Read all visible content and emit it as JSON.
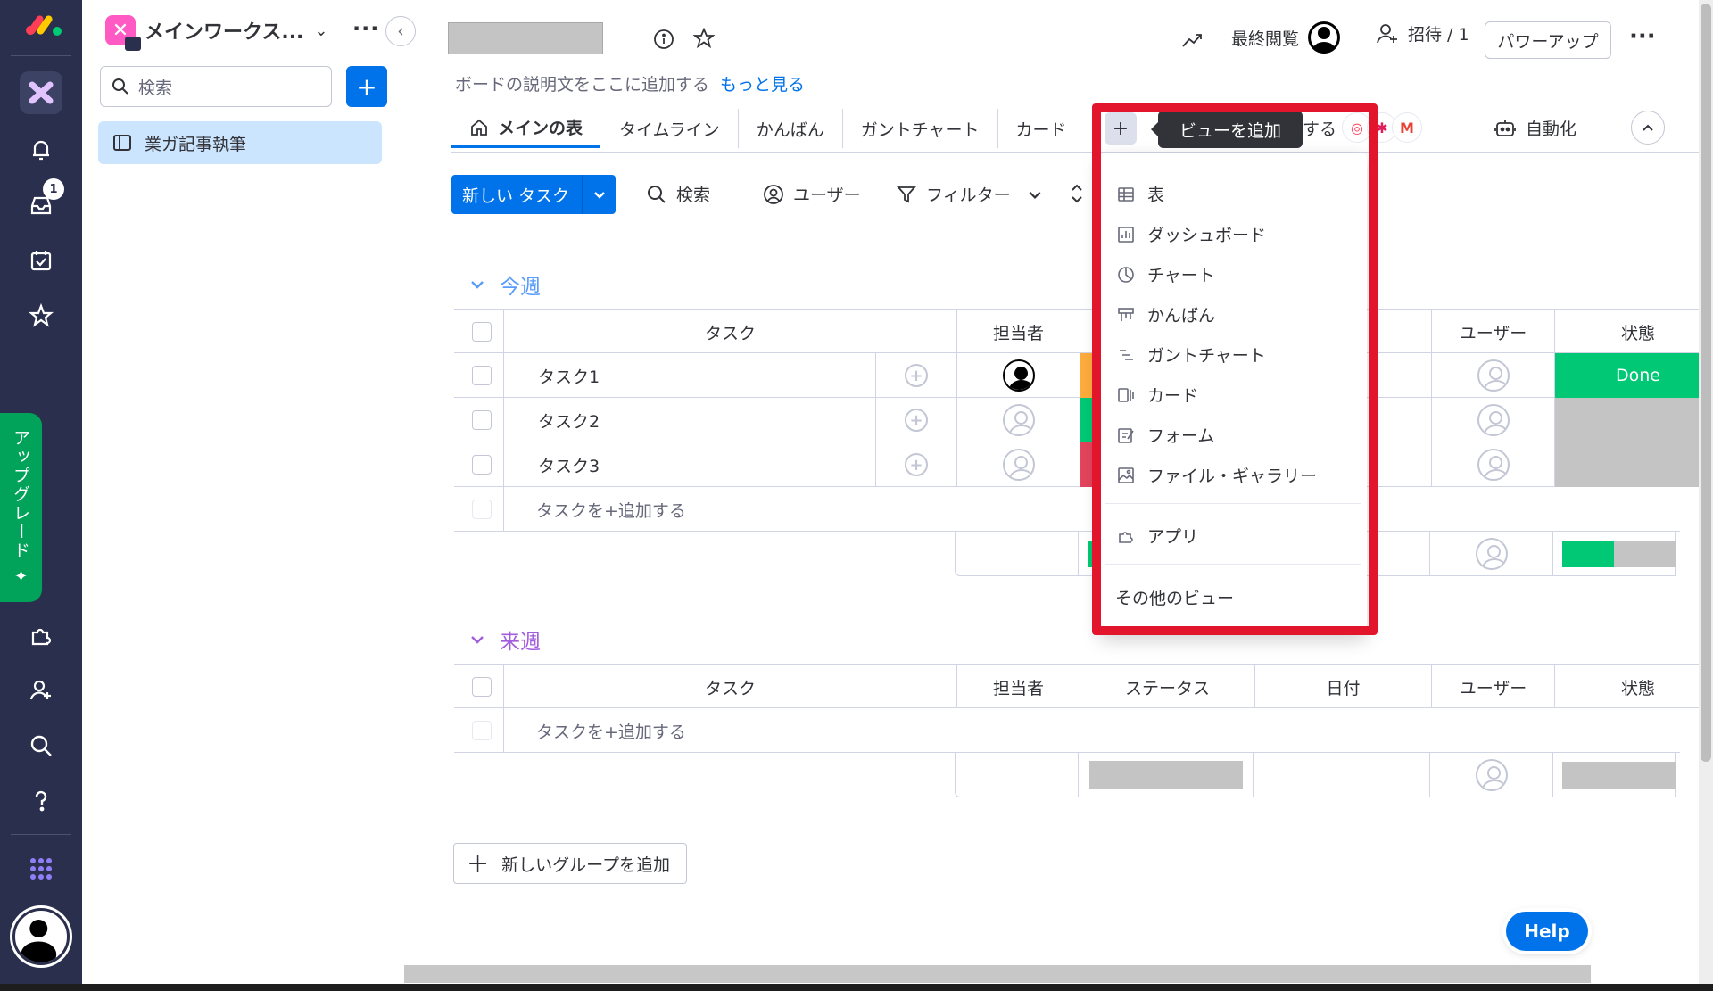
{
  "workspace": {
    "name": "メインワークス...",
    "search_placeholder": "検索",
    "board_item": "業ガ記事執筆"
  },
  "rail": {
    "upgrade_label": "アップグレード",
    "inbox_badge": "1"
  },
  "header": {
    "description": "ボードの説明文をここに追加する",
    "more_link": "もっと見る",
    "last_viewed": "最終閲覧",
    "invite": "招待 / 1",
    "powerup": "パワーアップ"
  },
  "tabs": [
    {
      "label": "メインの表"
    },
    {
      "label": "タイムライン"
    },
    {
      "label": "かんばん"
    },
    {
      "label": "ガントチャート"
    },
    {
      "label": "カード"
    }
  ],
  "tab_partial": "する",
  "tooltip": "ビューを追加",
  "automate": "自動化",
  "toolbar": {
    "new_task": "新しい タスク",
    "search": "検索",
    "user": "ユーザー",
    "filter": "フィルター"
  },
  "groups": [
    {
      "title": "今週",
      "color": "#579bfc",
      "columns": {
        "task": "タスク",
        "owner": "担当者",
        "user": "ユーザー",
        "state": "状態"
      },
      "rows": [
        {
          "name": "タスク1",
          "status_color": "#fdab3d",
          "state": "Done",
          "state_color": "#00c875"
        },
        {
          "name": "タスク2",
          "status_color": "#00c875",
          "state": "",
          "state_color": "#c4c4c4"
        },
        {
          "name": "タスク3",
          "status_color": "#e2445c",
          "state": "",
          "state_color": "#c4c4c4"
        }
      ],
      "add_task": "タスクを+追加する"
    },
    {
      "title": "来週",
      "color": "#a25ddc",
      "columns": {
        "task": "タスク",
        "owner": "担当者",
        "status": "ステータス",
        "date": "日付",
        "user": "ユーザー",
        "state": "状態"
      },
      "add_task": "タスクを+追加する"
    }
  ],
  "view_menu": {
    "items": [
      "表",
      "ダッシュボード",
      "チャート",
      "かんばん",
      "ガントチャート",
      "カード",
      "フォーム",
      "ファイル・ギャラリー"
    ],
    "apps": "アプリ",
    "other": "その他のビュー"
  },
  "add_group": "新しいグループを追加",
  "help": "Help"
}
